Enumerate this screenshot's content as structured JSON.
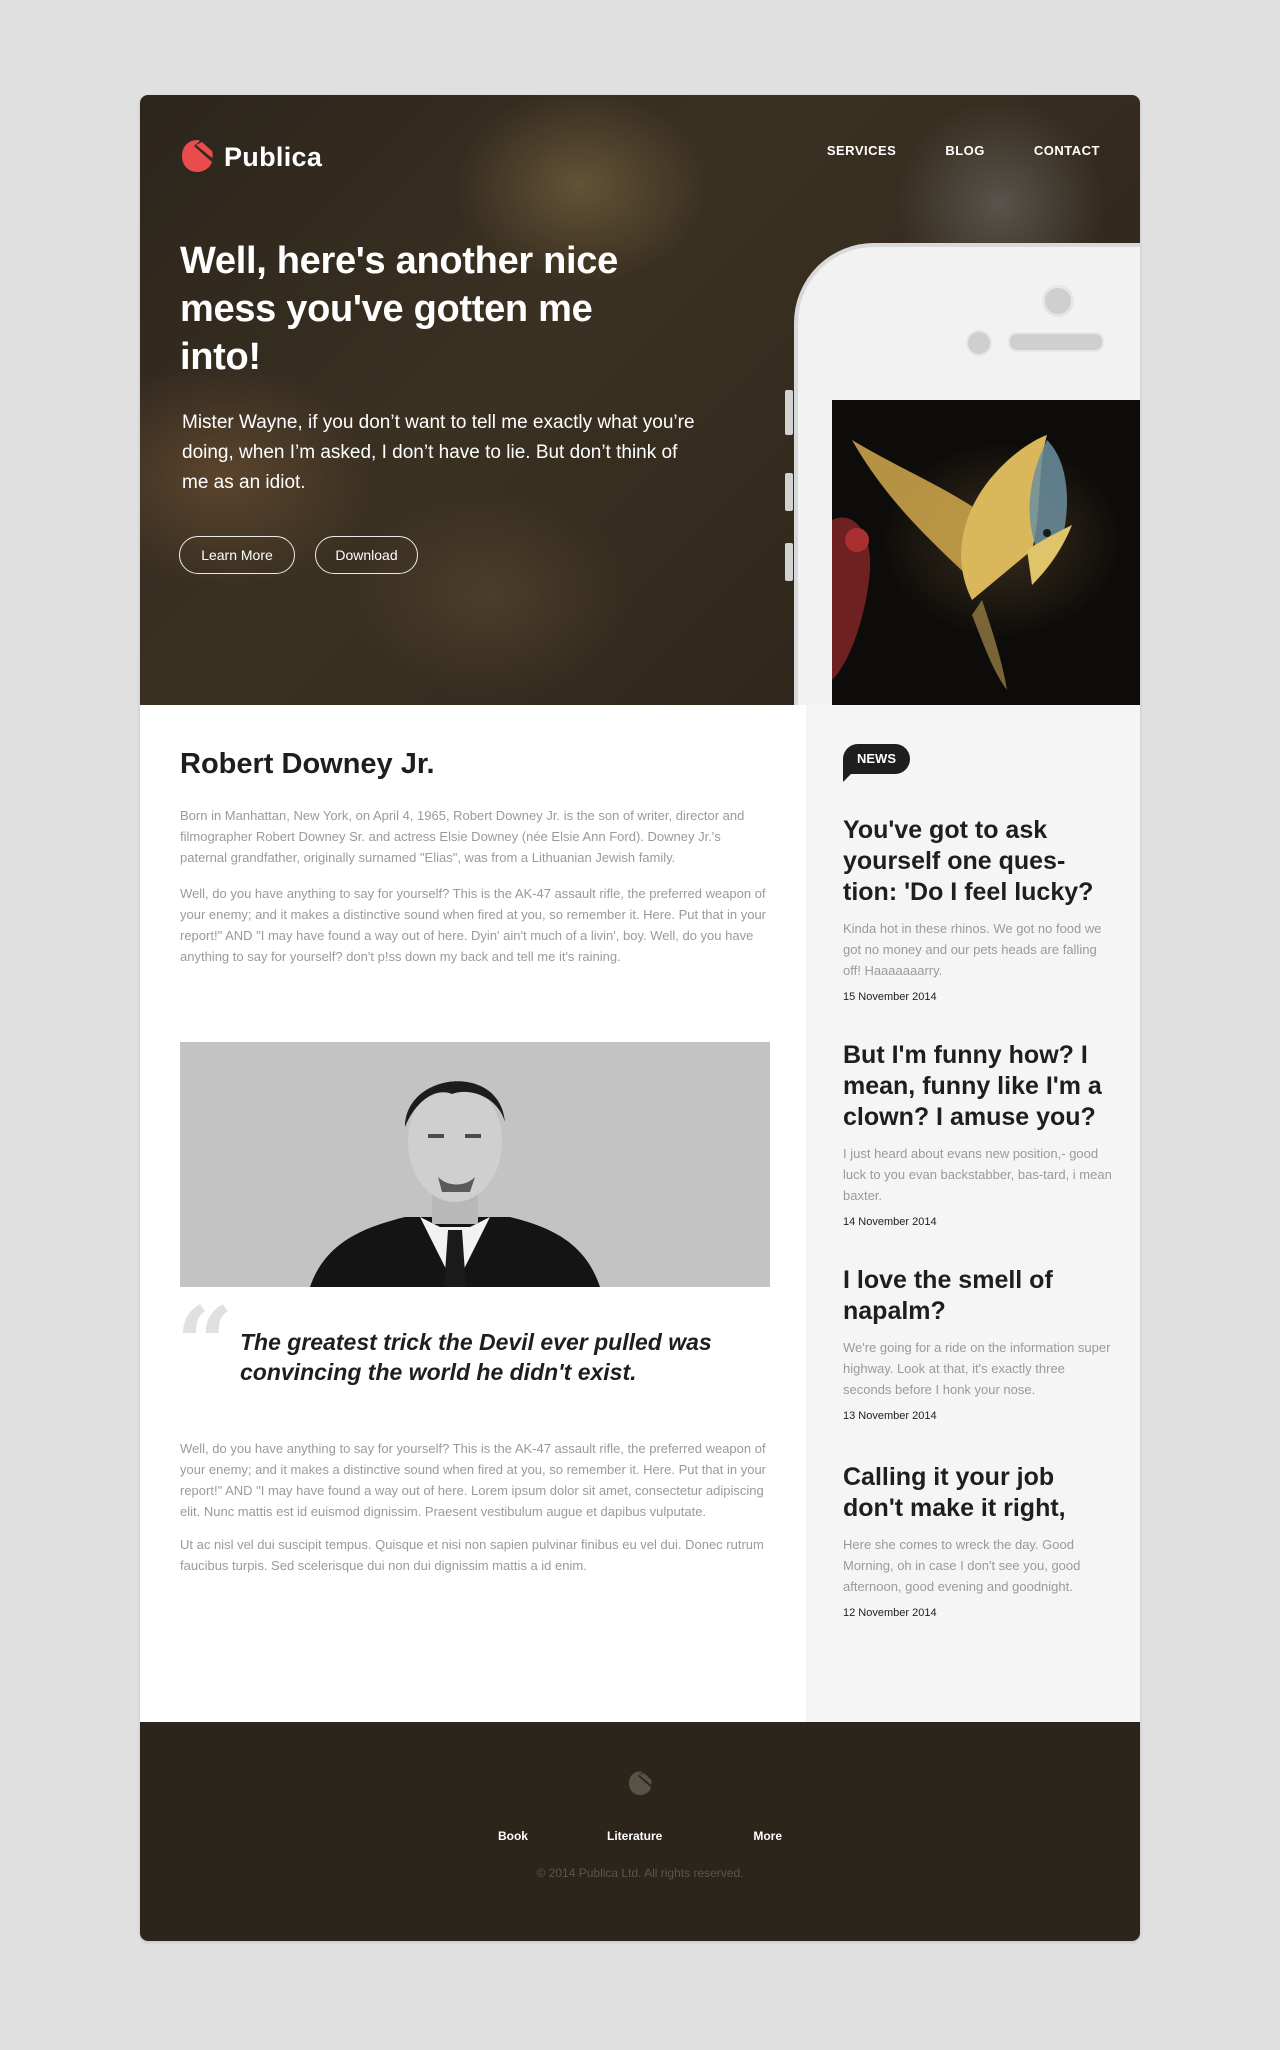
{
  "brand": {
    "name": "Publica",
    "accent": "#e84c4c"
  },
  "nav": {
    "items": [
      "SERVICES",
      "BLOG",
      "CONTACT"
    ]
  },
  "hero": {
    "title": "Well, here's another nice mess you've gotten me into!",
    "subtitle": "Mister Wayne, if you don’t want to tell me exactly what you’re doing, when I’m asked, I don’t have to lie. But don’t think of me as an idiot.",
    "learn_more": "Learn More",
    "download": "Download"
  },
  "article": {
    "title": "Robert Downey Jr.",
    "paragraphs": [
      "Born in Manhattan, New York, on April 4, 1965, Robert Downey Jr. is the son of writer, director and filmographer Robert Downey Sr. and actress Elsie Downey (née Elsie Ann Ford). Downey Jr.'s paternal grandfather, originally surnamed \"Elias\", was from a Lithuanian Jewish family.",
      "Well, do you have anything to say for yourself? This is the AK-47 assault rifle, the preferred weapon of your enemy; and it makes a distinctive sound when fired at you, so remember it. Here. Put that in your report!\" AND \"I may have found a way out of here. Dyin' ain't much of a livin', boy. Well, do you have anything to say for yourself? don't p!ss down my back and tell me it's raining.",
      "Well, do you have anything to say for yourself? This is the AK-47 assault rifle, the preferred weapon of your enemy; and it makes a distinctive sound when fired at you, so remember it. Here. Put that in your report!\" AND \"I may have found a way out of here.  Lorem ipsum dolor sit amet, consectetur adipiscing elit. Nunc mattis est id euismod dignissim. Praesent vestibulum augue et dapibus vulputate.",
      "Ut ac nisl vel dui suscipit tempus. Quisque et nisi non sapien pulvinar finibus eu vel dui. Donec rutrum faucibus turpis. Sed scelerisque dui non dui dignissim mattis a id enim."
    ],
    "quote_mark": "“",
    "quote": "The greatest trick the Devil ever pulled was convincing the world he didn't exist."
  },
  "sidebar": {
    "badge": "NEWS",
    "items": [
      {
        "title": "You've got to ask yourself one ques-tion: 'Do I feel lucky?",
        "excerpt": "Kinda hot in these rhinos. We got no food we got no money and our pets heads are falling off! Haaaaaaarry.",
        "date": "15 November 2014"
      },
      {
        "title": "But I'm funny how? I mean, funny like I'm a clown? I amuse you?",
        "excerpt": "I just heard about evans new position,- good luck to you evan backstabber, bas-tard, i mean baxter.",
        "date": "14 November 2014"
      },
      {
        "title": "I love the smell of napalm?",
        "excerpt": "We're going for a ride on the information super highway. Look at that, it's exactly three seconds before I honk your nose.",
        "date": "13 November 2014"
      },
      {
        "title": "Calling it your job don't make it right,",
        "excerpt": "Here she comes to wreck the day. Good Morning, oh in case I don't see you, good afternoon, good evening and goodnight.",
        "date": "12 November 2014"
      }
    ]
  },
  "footer": {
    "links": [
      "Book",
      "Literature",
      "More"
    ],
    "copyright": "© 2014 Publica Ltd. All rights reserved."
  }
}
